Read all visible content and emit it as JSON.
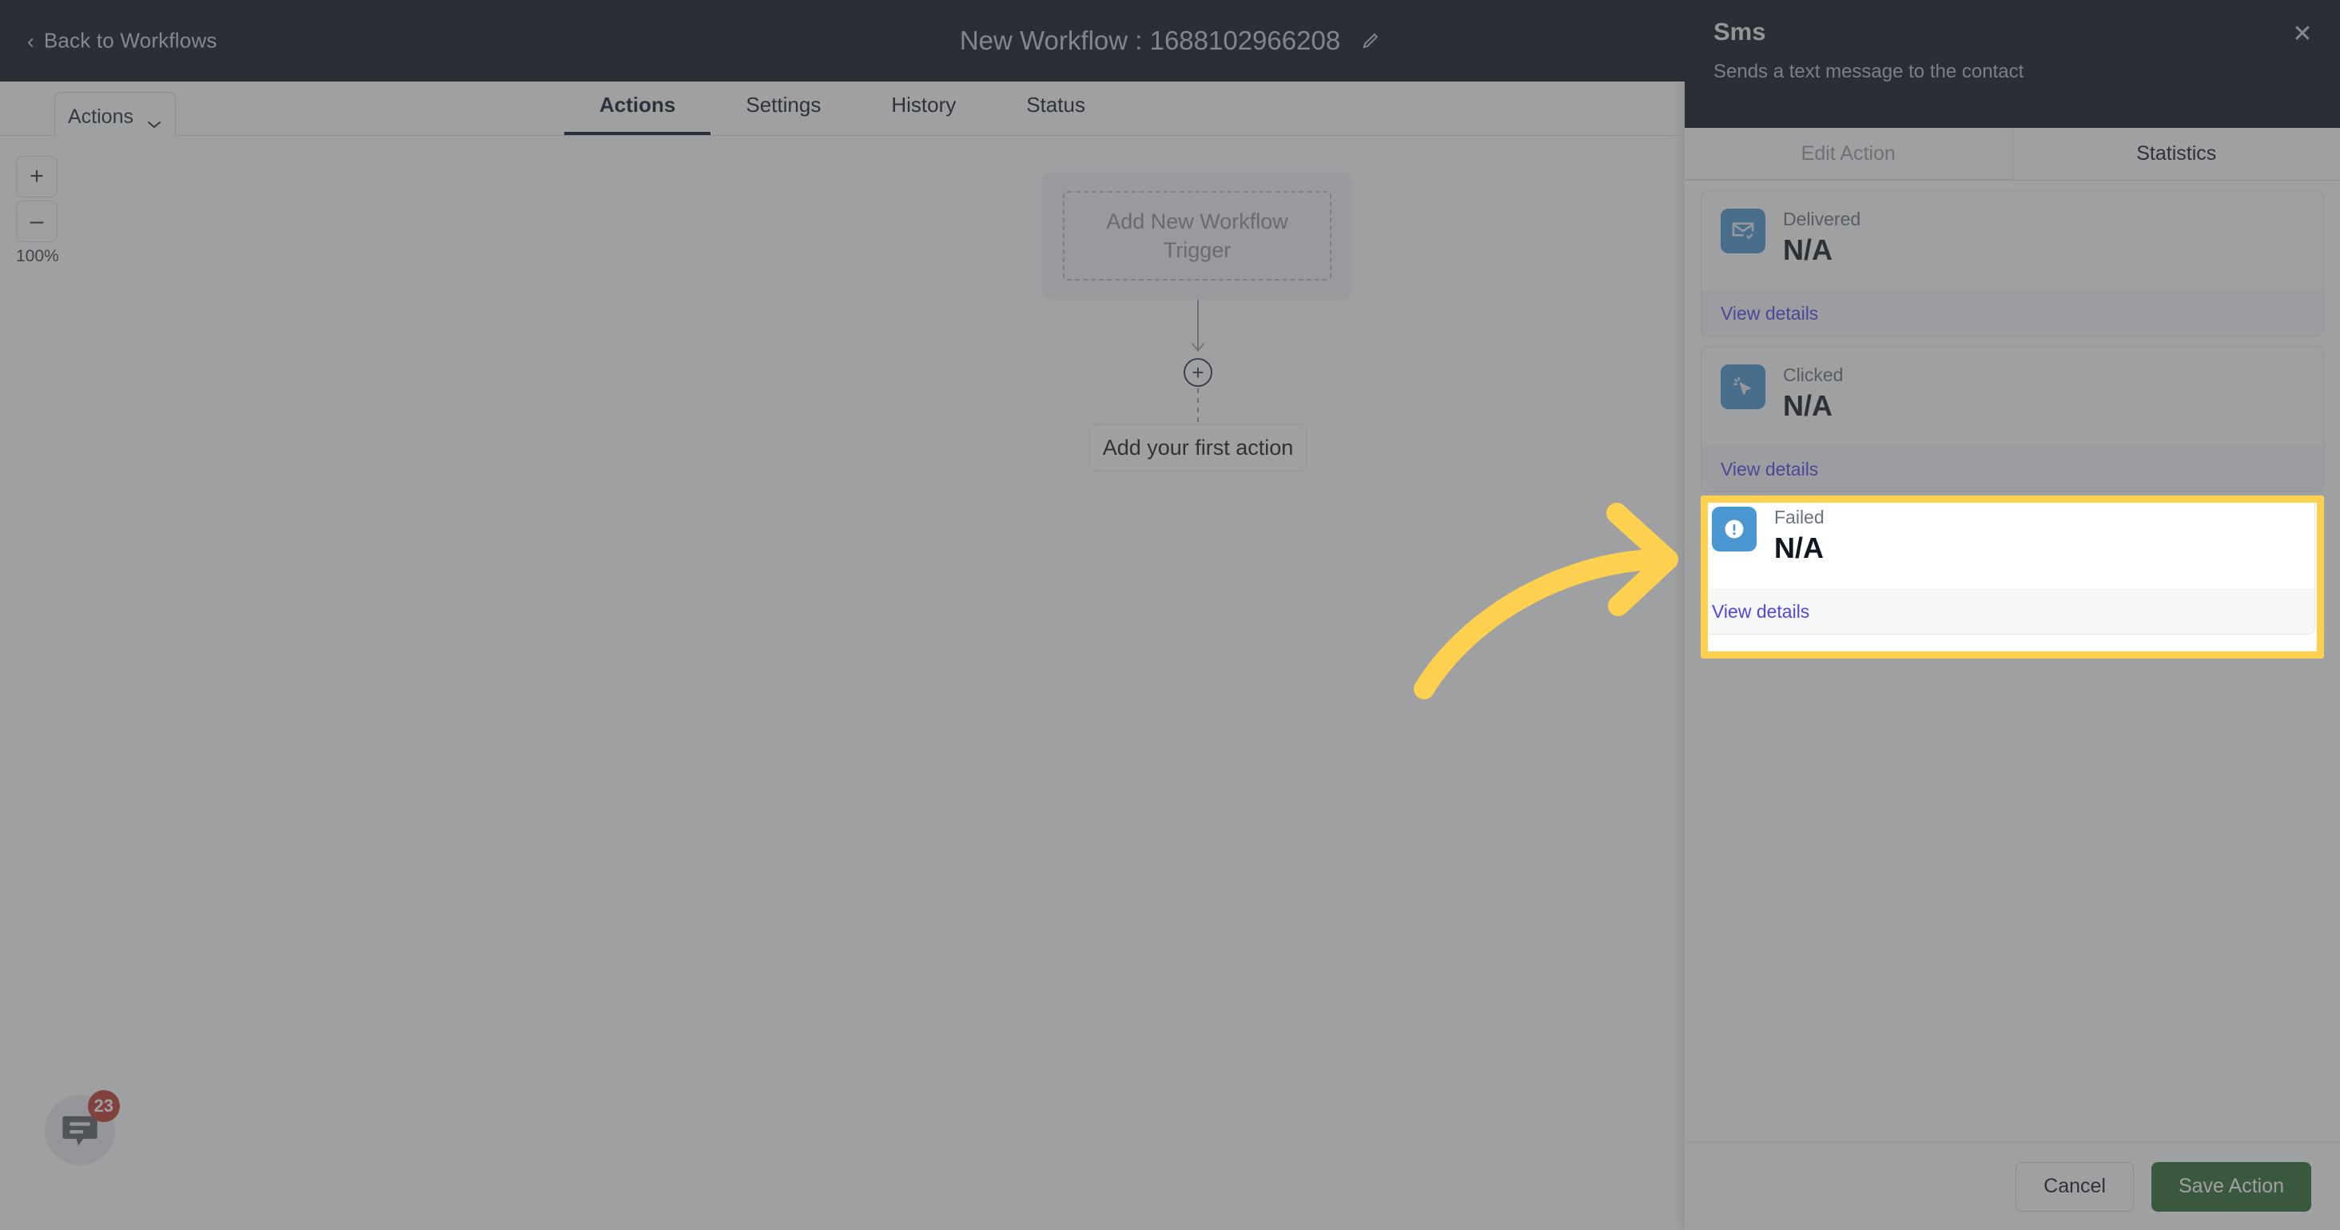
{
  "topbar": {
    "back_label": "Back to Workflows",
    "back_chevron_icon": "chevron-left-icon",
    "workflow_title": "New Workflow : 1688102966208",
    "edit_icon": "pencil-icon"
  },
  "toolbar": {
    "actions_label": "Actions",
    "actions_chevron_icon": "chevron-down-icon"
  },
  "tabs": [
    {
      "label": "Actions",
      "active": true
    },
    {
      "label": "Settings",
      "active": false
    },
    {
      "label": "History",
      "active": false
    },
    {
      "label": "Status",
      "active": false
    }
  ],
  "canvas": {
    "zoom_in_label": "+",
    "zoom_out_label": "–",
    "zoom_percent": "100%",
    "trigger_placeholder": "Add New Workflow Trigger",
    "add_node_label": "+",
    "first_action_label": "Add your first action"
  },
  "chat_widget": {
    "icon": "chat-bubble-icon",
    "badge_count": "23"
  },
  "panel": {
    "title": "Sms",
    "subtitle": "Sends a text message to the contact",
    "close_icon": "close-icon",
    "tabs": [
      {
        "label": "Edit Action",
        "active": false
      },
      {
        "label": "Statistics",
        "active": true
      }
    ],
    "stats": [
      {
        "label": "Delivered",
        "value": "N/A",
        "icon": "mail-check-icon",
        "link_label": "View details",
        "highlighted": false
      },
      {
        "label": "Clicked",
        "value": "N/A",
        "icon": "cursor-click-icon",
        "link_label": "View details",
        "highlighted": false
      },
      {
        "label": "Failed",
        "value": "N/A",
        "icon": "alert-circle-icon",
        "link_label": "View details",
        "highlighted": true
      }
    ],
    "footer": {
      "cancel_label": "Cancel",
      "save_label": "Save Action"
    }
  },
  "annotation": {
    "highlight_color": "#fdd04f",
    "arrow_color": "#fdd04f",
    "arrow_icon": "curved-arrow-right-icon"
  },
  "colors": {
    "topbar_bg": "#0b141c",
    "accent_green": "#2d6a2d",
    "link_blue": "#4f46e5",
    "stat_icon_blue": "#4a97d1",
    "badge_red": "#c0392b"
  }
}
